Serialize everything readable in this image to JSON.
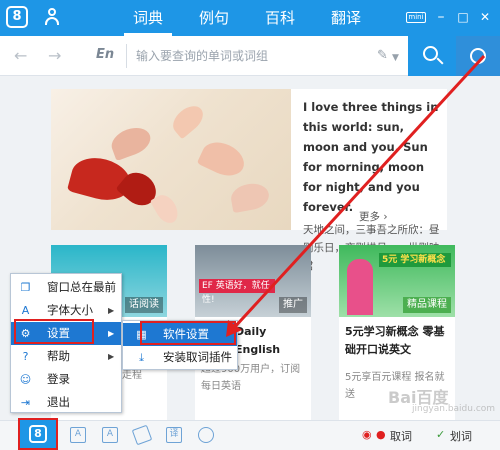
{
  "titlebar": {
    "logo": "8",
    "tabs": [
      {
        "label": "词典",
        "active": true
      },
      {
        "label": "例句",
        "active": false
      },
      {
        "label": "百科",
        "active": false
      },
      {
        "label": "翻译",
        "active": false
      }
    ],
    "mini_label": "mini",
    "minimize": "–",
    "maximize": "□",
    "close": "✕"
  },
  "search": {
    "lang": "En",
    "placeholder": "输入要查询的单词或词组",
    "back_icon": "←",
    "forward_icon": "→"
  },
  "hero": {
    "en_text": "I love three things in this world: sun, moon and you. Sun for morning, moon for night, and you forever.",
    "cn_text": "天地之间，三事吾之所欣：昼则乐日，夜则惜月，一世则映君",
    "more": "更多 ›"
  },
  "cards": [
    {
      "title": "",
      "sub": "",
      "tag": "话阅读"
    },
    {
      "title": "Daily English",
      "sub": "超过900万用户，订阅每日英语",
      "tag": "推广",
      "img_text": "EF 英语好，就任性!"
    },
    {
      "title": "5元学习新概念 零基础开口说英文",
      "sub": "5元享百元课程 报名就送",
      "tag": "精品课程",
      "img_text": "5元 学习新概念"
    }
  ],
  "menu": {
    "items": [
      {
        "label": "窗口总在最前",
        "icon": "window-icon"
      },
      {
        "label": "字体大小",
        "icon": "font-size-icon",
        "has_sub": true
      },
      {
        "label": "设置",
        "icon": "gear-icon",
        "has_sub": true,
        "selected": true
      },
      {
        "label": "帮助",
        "icon": "help-icon",
        "has_sub": true
      },
      {
        "label": "登录",
        "icon": "user-icon"
      },
      {
        "label": "退出",
        "icon": "exit-icon"
      }
    ]
  },
  "submenu": {
    "items": [
      {
        "label": "软件设置",
        "icon": "settings-icon",
        "selected": true
      },
      {
        "label": "安装取词插件",
        "icon": "download-icon"
      }
    ]
  },
  "card1_partial": "走程",
  "bottombar": {
    "icon_labels": [
      "A",
      "A",
      "",
      "译",
      ""
    ],
    "quci_label": "取词",
    "huaci_label": "划词"
  },
  "watermark": {
    "main": "Bai百度",
    "sub": "jingyan.baidu.com"
  },
  "colors": {
    "accent": "#1e96e6",
    "highlight": "#e02020",
    "menu_selected": "#1e78d2"
  }
}
